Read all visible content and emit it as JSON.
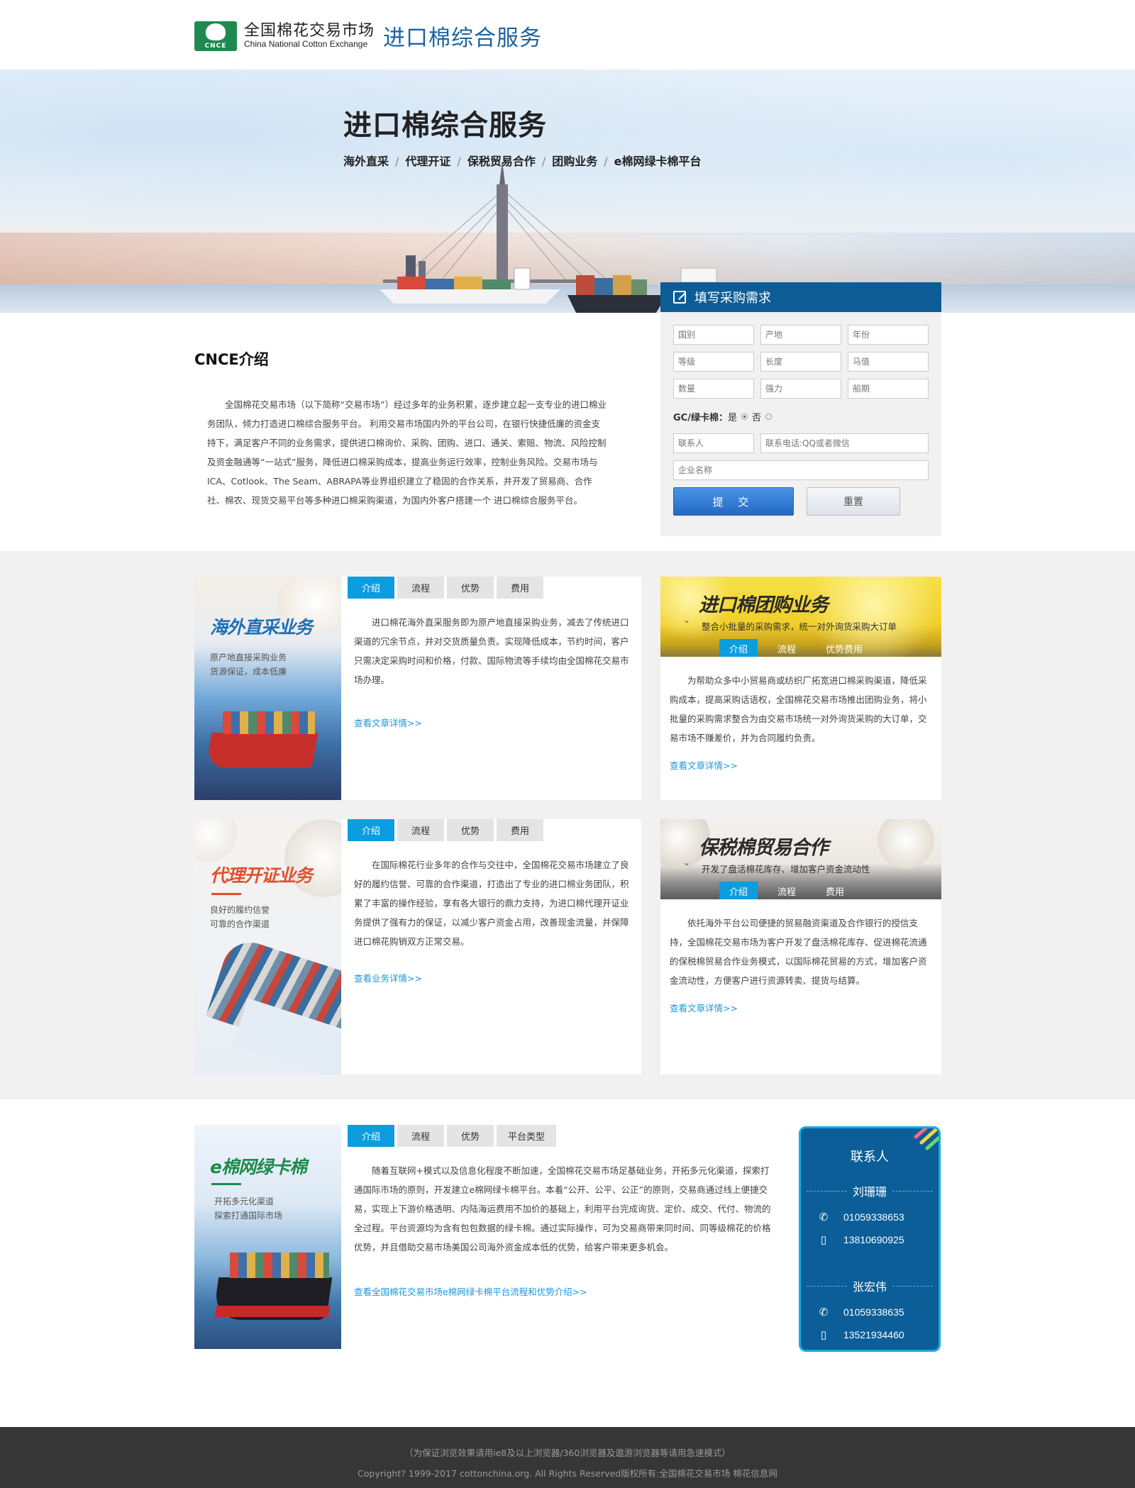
{
  "header": {
    "logo_mark": "CNCE",
    "logo_cn": "全国棉花交易市场",
    "logo_en": "China National Cotton Exchange",
    "service": "进口棉综合服务"
  },
  "banner": {
    "title": "进口棉综合服务",
    "nav": [
      "海外直采",
      "代理开证",
      "保税贸易合作",
      "团购业务",
      "e棉网绿卡棉平台"
    ],
    "separator": "/"
  },
  "form": {
    "title": "填写采购需求",
    "row1": [
      "国别",
      "产地",
      "年份"
    ],
    "row2": [
      "等级",
      "长度",
      "马值"
    ],
    "row3": [
      "数量",
      "强力",
      "船期"
    ],
    "gc_label": "GC/绿卡棉：",
    "gc_yes": "是",
    "gc_no": "否",
    "contact_placeholder": "联系人",
    "phone_placeholder": "联系电话:QQ或者微信",
    "company_placeholder": "企业名称",
    "submit": "提 交",
    "reset": "重置"
  },
  "intro": {
    "title": "CNCE介绍",
    "text": "全国棉花交易市场（以下简称“交易市场”）经过多年的业务积累，逐步建立起一支专业的进口棉业务团队，倾力打造进口棉综合服务平台。 利用交易市场国内外的平台公司，在银行快捷低廉的资金支持下，满足客户不同的业务需求，提供进口棉询价、采购、团购、进口、通关、索赔、物流、风险控制及资金融通等“一站式”服务，降低进口棉采购成本，提高业务运行效率，控制业务风险。交易市场与ICA、Cotlook、The Seam、ABRAPA等业界组织建立了稳固的合作关系，并开发了贸易商、合作社、棉农、现货交易平台等多种进口棉采购渠道，为国内外客户搭建一个 进口棉综合服务平台。"
  },
  "tabs4": [
    "介绍",
    "流程",
    "优势",
    "费用"
  ],
  "services": {
    "overseas": {
      "img_title": "海外直采业务",
      "img_sub": [
        "原产地直接采购业务",
        "货源保证，成本低廉"
      ],
      "text": "进口棉花海外直采服务即为原产地直接采购业务，减去了传统进口渠道的冗余节点，并对交货质量负责。实现降低成本，节约时间，客户只需决定采购时间和价格，付款、国际物流等手续均由全国棉花交易市场办理。",
      "more": "查看文章详情>>"
    },
    "agent": {
      "img_title": "代理开证业务",
      "img_sub": [
        "良好的履约信誉",
        "可靠的合作渠道"
      ],
      "text": "在国际棉花行业多年的合作与交往中，全国棉花交易市场建立了良好的履约信誉、可靠的合作渠道，打造出了专业的进口棉业务团队，积累了丰富的操作经验，享有各大银行的鼎力支持，为进口棉代理开证业务提供了强有力的保证，以减少客户资金占用，改善现金流量，并保障进口棉花购销双方正常交易。",
      "more": "查看业务详情>>"
    },
    "group": {
      "title": "进口棉团购业务",
      "sub": "整合小批量的采购需求，统一对外询货采购大订单",
      "tabs": [
        "介绍",
        "流程",
        "优势费用"
      ],
      "text": "为帮助众多中小贸易商或纺织厂拓宽进口棉采购渠道，降低采购成本，提高采购话语权，全国棉花交易市场推出团购业务，将小批量的采购需求整合为由交易市场统一对外询货采购的大订单，交易市场不赚差价，并为合同履约负责。",
      "more": "查看文章详情>>"
    },
    "bonded": {
      "title": "保税棉贸易合作",
      "sub": "开发了盘活棉花库存、增加客户资金流动性",
      "tabs": [
        "介绍",
        "流程",
        "费用"
      ],
      "text": "依托海外平台公司便捷的贸易融资渠道及合作银行的授信支持，全国棉花交易市场为客户开发了盘活棉花库存、促进棉花流通的保税棉贸易合作业务模式，以国际棉花贸易的方式，增加客户资金流动性，方便客户进行资源转卖、提货与结算。",
      "more": "查看文章详情>>"
    }
  },
  "ecotton": {
    "img_title": "e棉网绿卡棉",
    "img_sub": [
      "开拓多元化渠道",
      "探索打通国际市场"
    ],
    "tabs": [
      "介绍",
      "流程",
      "优势",
      "平台类型"
    ],
    "text": "随着互联网+模式以及信息化程度不断加速，全国棉花交易市场足基础业务，开拓多元化渠道，探索打通国际市场的原则，开发建立e棉网绿卡棉平台。本着“公开、公平、公正”的原则，交易商通过线上便捷交易，实现上下游价格透明、内陆海运费用不加价的基础上，利用平台完成询货、定价、成交、代付、物流的全过程。平台资源均为含有包包数据的绿卡棉。通过实际操作，可为交易商带来同时间、同等级棉花的价格优势，并且借助交易市场美国公司海外资金成本低的优势，给客户带来更多机会。",
    "more": "查看全国棉花交易市场e棉网绿卡棉平台流程和优势介绍>>"
  },
  "contact": {
    "title": "联系人",
    "people": [
      {
        "name": "刘珊珊",
        "tel": "01059338653",
        "mobile": "13810690925"
      },
      {
        "name": "张宏伟",
        "tel": "01059338635",
        "mobile": "13521934460"
      }
    ]
  },
  "footer": {
    "line1": "（为保证浏览效果请用ie8及以上浏览器/360浏览器及遨游浏览器等请用急速模式）",
    "line2": "Copyright? 1999-2017 cottonchina.org. All Rights Reserved版权所有:全国棉花交易市场 棉花信息网"
  },
  "colors": {
    "brand_blue": "#0d5c95",
    "tab_active": "#0c9de0",
    "link": "#1b96d8",
    "footer_bg": "#363636"
  }
}
